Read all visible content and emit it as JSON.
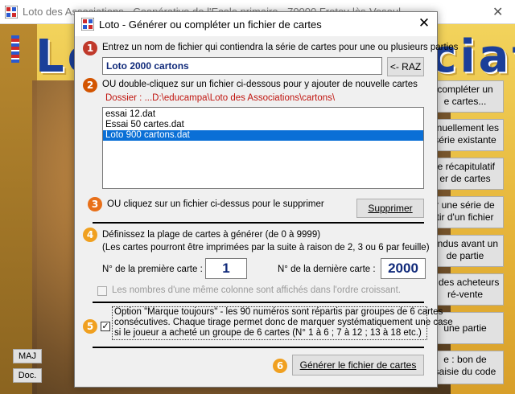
{
  "main_window": {
    "title": "Loto des Associations - Coopérative de l'Ecole primaire - 70000 Frotey-lès-Vesoul",
    "bg_title": "Loto des Associations",
    "side_buttons": [
      {
        "line1": "compléter un",
        "line2": "e cartes..."
      },
      {
        "line1": "anuellement les",
        "line2": "série existante"
      },
      {
        "line1": "le récapitulatif",
        "line2": "er de cartes"
      },
      {
        "line1": "r une série de",
        "line2": "tir d'un fichier"
      },
      {
        "line1": "endus avant un",
        "line2": "de partie"
      },
      {
        "line1": "s des acheteurs",
        "line2": "ré-vente"
      },
      {
        "line1": "une partie",
        "line2": ""
      },
      {
        "line1": "e : bon de",
        "line2": "saisie du code"
      }
    ],
    "maj_label": "MAJ",
    "doc_label": "Doc."
  },
  "dialog": {
    "title": "Loto - Générer ou compléter un fichier de cartes",
    "step1": {
      "badge": "1",
      "instruction": "Entrez un nom de fichier qui contiendra la série de cartes pour une ou plusieurs parties",
      "filename_value": "Loto 2000 cartons",
      "raz_button": "<- RAZ"
    },
    "step2": {
      "badge": "2",
      "instruction": "OU double-cliquez sur un fichier ci-dessous pour y ajouter de nouvelle cartes",
      "folder_path": "Dossier : ...D:\\educampa\\Loto des Associations\\cartons\\",
      "files": [
        "essai 12.dat",
        "Essai 50 cartes.dat",
        "Loto 900 cartons.dat"
      ],
      "selected_index": 2
    },
    "step3": {
      "badge": "3",
      "instruction": "OU cliquez sur un fichier ci-dessus pour le supprimer",
      "delete_button": "Supprimer"
    },
    "step4": {
      "badge": "4",
      "line1": "Définissez la plage de cartes à générer (de 0 à 9999)",
      "line2": "(Les cartes pourront être imprimées par la suite à raison de 2, 3 ou 6 par feuille)",
      "first_label": "N° de la première carte :",
      "first_value": "1",
      "last_label": "N° de la dernière carte :",
      "last_value": "2000",
      "sorted_option": "Les nombres d'une même colonne sont affichés dans l'ordre croissant."
    },
    "step5": {
      "badge": "5",
      "checked": true,
      "check_mark": "✓",
      "line1": "Option \"Marque toujours\" - les 90 numéros sont répartis par groupes de 6 cartes",
      "line2": "consécutives. Chaque tirage permet donc de marquer systématiquement une case",
      "line3": "si le joueur a acheté un groupe de 6 cartes (N° 1 à 6 ; 7 à 12 ; 13 à 18 etc.)"
    },
    "step6": {
      "badge": "6",
      "generate_button": "Générer le fichier de cartes"
    },
    "close_glyph": "✕"
  },
  "colors": {
    "badge": "#e8701a",
    "selection": "#0a6fd6",
    "input_text": "#102a7a",
    "path_text": "#c0150f"
  }
}
